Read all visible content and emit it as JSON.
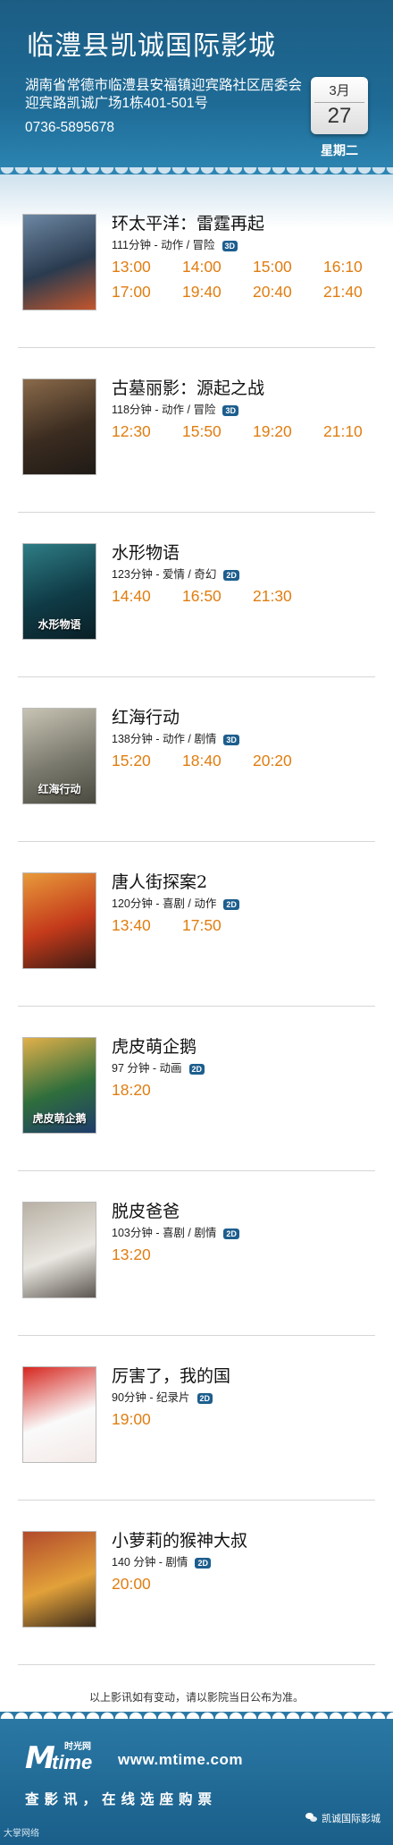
{
  "header": {
    "cinema_name": "临澧县凯诚国际影城",
    "address": "湖南省常德市临澧县安福镇迎宾路社区居委会迎宾路凯诚广场1栋401-501号",
    "phone": "0736-5895678",
    "date": {
      "month": "3月",
      "day": "27",
      "weekday": "星期二"
    }
  },
  "movies": [
    {
      "title": "环太平洋：雷霆再起",
      "meta": "111分钟 - 动作 / 冒险",
      "format": "3D",
      "times": [
        "13:00",
        "14:00",
        "15:00",
        "16:10",
        "17:00",
        "19:40",
        "20:40",
        "21:40"
      ],
      "poster_colors": [
        "#2a3b4f",
        "#6d87a3",
        "#c4562c"
      ]
    },
    {
      "title": "古墓丽影：源起之战",
      "meta": "118分钟 - 动作 / 冒险",
      "format": "3D",
      "times": [
        "12:30",
        "15:50",
        "19:20",
        "21:10"
      ],
      "poster_colors": [
        "#3b2c20",
        "#8a6a4a",
        "#1f1a16"
      ]
    },
    {
      "title": "水形物语",
      "meta": "123分钟 - 爱情 / 奇幻",
      "format": "2D",
      "times": [
        "14:40",
        "16:50",
        "21:30"
      ],
      "poster_colors": [
        "#0f3b46",
        "#2f7d85",
        "#0a1f26"
      ],
      "poster_text": "水形物语"
    },
    {
      "title": "红海行动",
      "meta": "138分钟 - 动作 / 剧情",
      "format": "3D",
      "times": [
        "15:20",
        "18:40",
        "20:20"
      ],
      "poster_colors": [
        "#7b7a6e",
        "#c8c4b4",
        "#4a4a40"
      ],
      "poster_text": "红海行动"
    },
    {
      "title": "唐人街探案2",
      "meta": "120分钟 - 喜剧 / 动作",
      "format": "2D",
      "times": [
        "13:40",
        "17:50"
      ],
      "poster_colors": [
        "#c43a1b",
        "#e89a3a",
        "#3b1c14"
      ]
    },
    {
      "title": "虎皮萌企鹅",
      "meta": "97 分钟 - 动画",
      "format": "2D",
      "times": [
        "18:20"
      ],
      "poster_colors": [
        "#2f6e3c",
        "#e2b04a",
        "#1e3b6a"
      ],
      "poster_text": "虎皮萌企鹅"
    },
    {
      "title": "脱皮爸爸",
      "meta": "103分钟 - 喜剧 / 剧情",
      "format": "2D",
      "times": [
        "13:20"
      ],
      "poster_colors": [
        "#e9e7e1",
        "#b8b0a4",
        "#5d5650"
      ]
    },
    {
      "title": "厉害了，我的国",
      "meta": "90分钟 - 纪录片",
      "format": "2D",
      "times": [
        "19:00"
      ],
      "poster_colors": [
        "#fafafa",
        "#d6261f",
        "#f3e9e6"
      ]
    },
    {
      "title": "小萝莉的猴神大叔",
      "meta": "140 分钟 - 剧情",
      "format": "2D",
      "times": [
        "20:00"
      ],
      "poster_colors": [
        "#e2a13a",
        "#b24a2c",
        "#3a2a1c"
      ]
    }
  ],
  "notice": "以上影讯如有变动，请以影院当日公布为准。",
  "footer": {
    "logo_mark": "M",
    "logo_time": "time",
    "logo_cn": "时光网",
    "site_url": "www.mtime.com",
    "slogan": "查影讯，在线选座购票",
    "watermark": "大掌网络",
    "account_name": "凯诚国际影城"
  },
  "colors": {
    "header": "#1e6b96",
    "showtime": "#e07d10",
    "format_badge": "#1d5e8e"
  }
}
